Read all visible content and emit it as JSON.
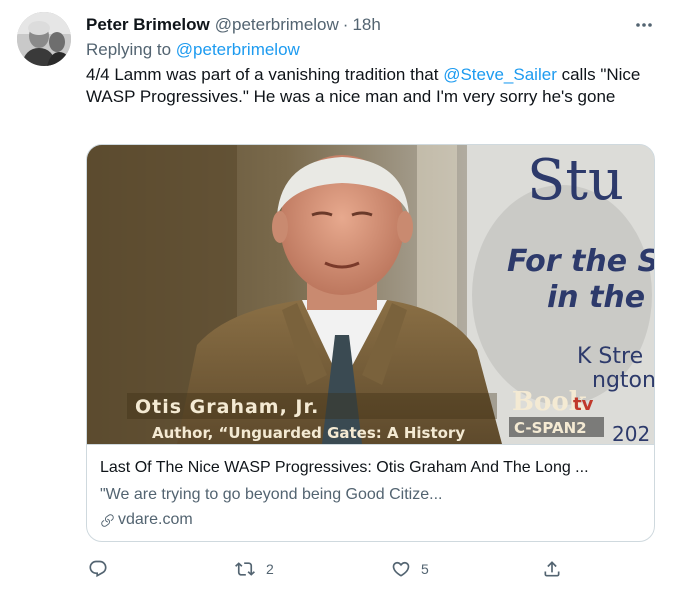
{
  "tweet": {
    "author_name": "Peter Brimelow",
    "handle": "@peterbrimelow",
    "separator": "·",
    "time": "18h",
    "replying_prefix": "Replying to",
    "replying_to": "@peterbrimelow",
    "text_before": "4/4 Lamm was part of a vanishing tradition that ",
    "mention": "@Steve_Sailer",
    "text_after": " calls \"Nice WASP Progressives.\" He was a nice man and I'm very sorry he's gone"
  },
  "card": {
    "media": {
      "caption_name": "Otis Graham, Jr.",
      "caption_subtitle": "Author, “Unguarded Gates: A History",
      "network_logo": "Book tv",
      "network_logo_book": "Book",
      "network_logo_tv": "tv",
      "network_name": "C-SPAN2",
      "bg_sign_text": "Stu",
      "bg_banner_line1": "For the S",
      "bg_banner_line2": "in the",
      "bg_banner_line3": "K Stre",
      "bg_banner_line4": "ngton",
      "bg_banner_line5": "202"
    },
    "title": "Last Of The Nice WASP Progressives: Otis Graham And The Long ...",
    "description": "\"We are trying to go beyond being Good Citize...",
    "domain": "vdare.com"
  },
  "actions": {
    "reply_count": "",
    "retweet_count": "2",
    "like_count": "5"
  },
  "colors": {
    "accent": "#1d9bf0",
    "secondary_text": "#536471",
    "border": "#cfd9de"
  },
  "icons": [
    "more-icon",
    "reply-icon",
    "retweet-icon",
    "like-icon",
    "share-icon",
    "link-icon"
  ]
}
